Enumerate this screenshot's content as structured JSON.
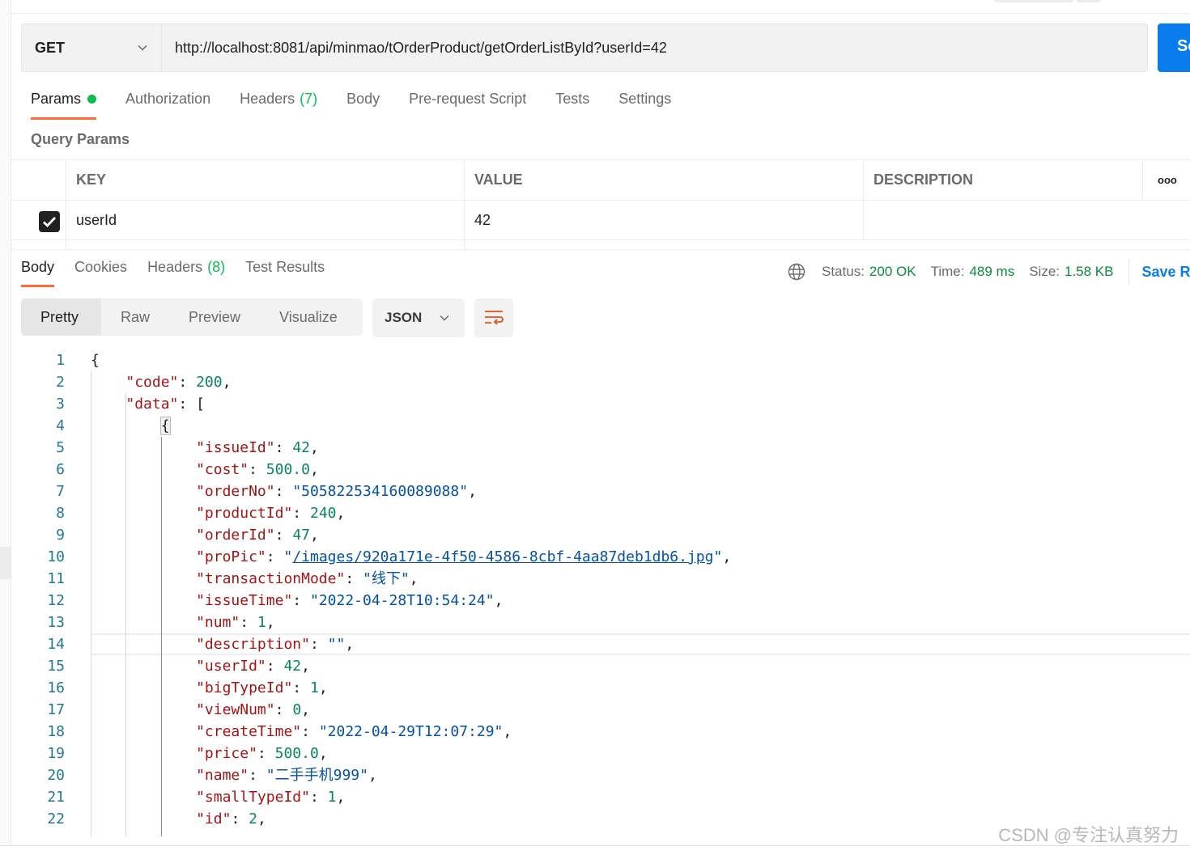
{
  "request": {
    "method": "GET",
    "url": "http://localhost:8081/api/minmao/tOrderProduct/getOrderListById?userId=42",
    "send_label": "Se"
  },
  "request_tabs": [
    {
      "label": "Params",
      "dot": true,
      "active": true
    },
    {
      "label": "Authorization"
    },
    {
      "label": "Headers",
      "count": "(7)"
    },
    {
      "label": "Body"
    },
    {
      "label": "Pre-request Script"
    },
    {
      "label": "Tests"
    },
    {
      "label": "Settings"
    }
  ],
  "query_params": {
    "title": "Query Params",
    "columns": [
      "KEY",
      "VALUE",
      "DESCRIPTION"
    ],
    "more_icon": "ooo",
    "rows": [
      {
        "checked": true,
        "key": "userId",
        "value": "42",
        "description": ""
      }
    ]
  },
  "response_tabs": [
    {
      "label": "Body",
      "active": true
    },
    {
      "label": "Cookies"
    },
    {
      "label": "Headers",
      "count": "(8)"
    },
    {
      "label": "Test Results"
    }
  ],
  "status": {
    "status_label": "Status:",
    "status": "200 OK",
    "time_label": "Time:",
    "time": "489 ms",
    "size_label": "Size:",
    "size": "1.58 KB",
    "save_label": "Save R"
  },
  "view_modes": [
    "Pretty",
    "Raw",
    "Preview",
    "Visualize"
  ],
  "format": "JSON",
  "colors": {
    "accent": "#ff6c37",
    "send": "#097bed",
    "success": "#0cbb52",
    "key": "#a31515",
    "number": "#098658",
    "string": "#0451a5"
  },
  "code_lines": [
    [
      0,
      [
        [
          "p",
          "{"
        ]
      ]
    ],
    [
      1,
      [
        [
          "k",
          "\"code\""
        ],
        [
          "p",
          ": "
        ],
        [
          "n",
          "200"
        ],
        [
          "p",
          ","
        ]
      ]
    ],
    [
      1,
      [
        [
          "k",
          "\"data\""
        ],
        [
          "p",
          ": ["
        ]
      ]
    ],
    [
      2,
      [
        [
          "p",
          "{"
        ]
      ]
    ],
    [
      3,
      [
        [
          "k",
          "\"issueId\""
        ],
        [
          "p",
          ": "
        ],
        [
          "n",
          "42"
        ],
        [
          "p",
          ","
        ]
      ]
    ],
    [
      3,
      [
        [
          "k",
          "\"cost\""
        ],
        [
          "p",
          ": "
        ],
        [
          "n",
          "500.0"
        ],
        [
          "p",
          ","
        ]
      ]
    ],
    [
      3,
      [
        [
          "k",
          "\"orderNo\""
        ],
        [
          "p",
          ": "
        ],
        [
          "s",
          "\"505822534160089088\""
        ],
        [
          "p",
          ","
        ]
      ]
    ],
    [
      3,
      [
        [
          "k",
          "\"productId\""
        ],
        [
          "p",
          ": "
        ],
        [
          "n",
          "240"
        ],
        [
          "p",
          ","
        ]
      ]
    ],
    [
      3,
      [
        [
          "k",
          "\"orderId\""
        ],
        [
          "p",
          ": "
        ],
        [
          "n",
          "47"
        ],
        [
          "p",
          ","
        ]
      ]
    ],
    [
      3,
      [
        [
          "k",
          "\"proPic\""
        ],
        [
          "p",
          ": "
        ],
        [
          "s",
          "\""
        ],
        [
          "u",
          "/images/920a171e-4f50-4586-8cbf-4aa87deb1db6.jpg"
        ],
        [
          "s",
          "\""
        ],
        [
          "p",
          ","
        ]
      ]
    ],
    [
      3,
      [
        [
          "k",
          "\"transactionMode\""
        ],
        [
          "p",
          ": "
        ],
        [
          "s",
          "\"线下\""
        ],
        [
          "p",
          ","
        ]
      ]
    ],
    [
      3,
      [
        [
          "k",
          "\"issueTime\""
        ],
        [
          "p",
          ": "
        ],
        [
          "s",
          "\"2022-04-28T10:54:24\""
        ],
        [
          "p",
          ","
        ]
      ]
    ],
    [
      3,
      [
        [
          "k",
          "\"num\""
        ],
        [
          "p",
          ": "
        ],
        [
          "n",
          "1"
        ],
        [
          "p",
          ","
        ]
      ]
    ],
    [
      3,
      [
        [
          "k",
          "\"description\""
        ],
        [
          "p",
          ": "
        ],
        [
          "s",
          "\"\""
        ],
        [
          "p",
          ","
        ]
      ]
    ],
    [
      3,
      [
        [
          "k",
          "\"userId\""
        ],
        [
          "p",
          ": "
        ],
        [
          "n",
          "42"
        ],
        [
          "p",
          ","
        ]
      ]
    ],
    [
      3,
      [
        [
          "k",
          "\"bigTypeId\""
        ],
        [
          "p",
          ": "
        ],
        [
          "n",
          "1"
        ],
        [
          "p",
          ","
        ]
      ]
    ],
    [
      3,
      [
        [
          "k",
          "\"viewNum\""
        ],
        [
          "p",
          ": "
        ],
        [
          "n",
          "0"
        ],
        [
          "p",
          ","
        ]
      ]
    ],
    [
      3,
      [
        [
          "k",
          "\"createTime\""
        ],
        [
          "p",
          ": "
        ],
        [
          "s",
          "\"2022-04-29T12:07:29\""
        ],
        [
          "p",
          ","
        ]
      ]
    ],
    [
      3,
      [
        [
          "k",
          "\"price\""
        ],
        [
          "p",
          ": "
        ],
        [
          "n",
          "500.0"
        ],
        [
          "p",
          ","
        ]
      ]
    ],
    [
      3,
      [
        [
          "k",
          "\"name\""
        ],
        [
          "p",
          ": "
        ],
        [
          "s",
          "\"二手手机999\""
        ],
        [
          "p",
          ","
        ]
      ]
    ],
    [
      3,
      [
        [
          "k",
          "\"smallTypeId\""
        ],
        [
          "p",
          ": "
        ],
        [
          "n",
          "1"
        ],
        [
          "p",
          ","
        ]
      ]
    ],
    [
      3,
      [
        [
          "k",
          "\"id\""
        ],
        [
          "p",
          ": "
        ],
        [
          "n",
          "2"
        ],
        [
          "p",
          ","
        ]
      ]
    ]
  ],
  "watermark": "CSDN @专注认真努力"
}
